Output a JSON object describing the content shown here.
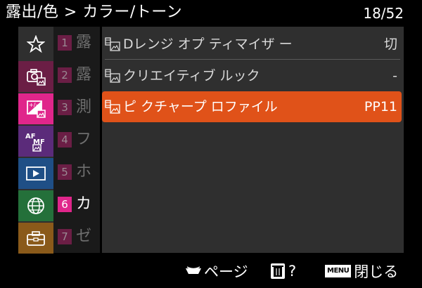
{
  "header": {
    "title": "露出/色 > カラー/トーン",
    "page_count": "18/52"
  },
  "sidebar": {
    "items": [
      {
        "icon": "star-icon"
      },
      {
        "icon": "camera-photo-icon",
        "color": "#6b1e45"
      },
      {
        "icon": "exposure-color-icon",
        "color": "#e0268b",
        "active": true
      },
      {
        "icon": "af-mf-icon",
        "color": "#5b2b7a"
      },
      {
        "icon": "playback-icon",
        "color": "#1f4f86"
      },
      {
        "icon": "network-globe-icon",
        "color": "#24703a"
      },
      {
        "icon": "toolbox-icon",
        "color": "#8a5a1a"
      }
    ]
  },
  "categories": [
    {
      "num": "1",
      "text": "露"
    },
    {
      "num": "2",
      "text": "露"
    },
    {
      "num": "3",
      "text": "測"
    },
    {
      "num": "4",
      "text": "フ"
    },
    {
      "num": "5",
      "text": "ホ"
    },
    {
      "num": "6",
      "text": "カ",
      "active": true
    },
    {
      "num": "7",
      "text": "ゼ"
    }
  ],
  "menu_items": [
    {
      "label": "Dレンジ オプ ティマイザ ー",
      "value": "切"
    },
    {
      "label": "クリエイティブ ルック",
      "value": "-"
    },
    {
      "label": "ピ クチャープ ロファイル",
      "value": "PP11",
      "selected": true
    }
  ],
  "footer": {
    "page_label": "ページ",
    "delete_help_label": "?",
    "menu_key": "MENU",
    "close_label": "閉じる"
  },
  "colors": {
    "selected_row": "#e05219",
    "active_category": "#e0268b"
  }
}
